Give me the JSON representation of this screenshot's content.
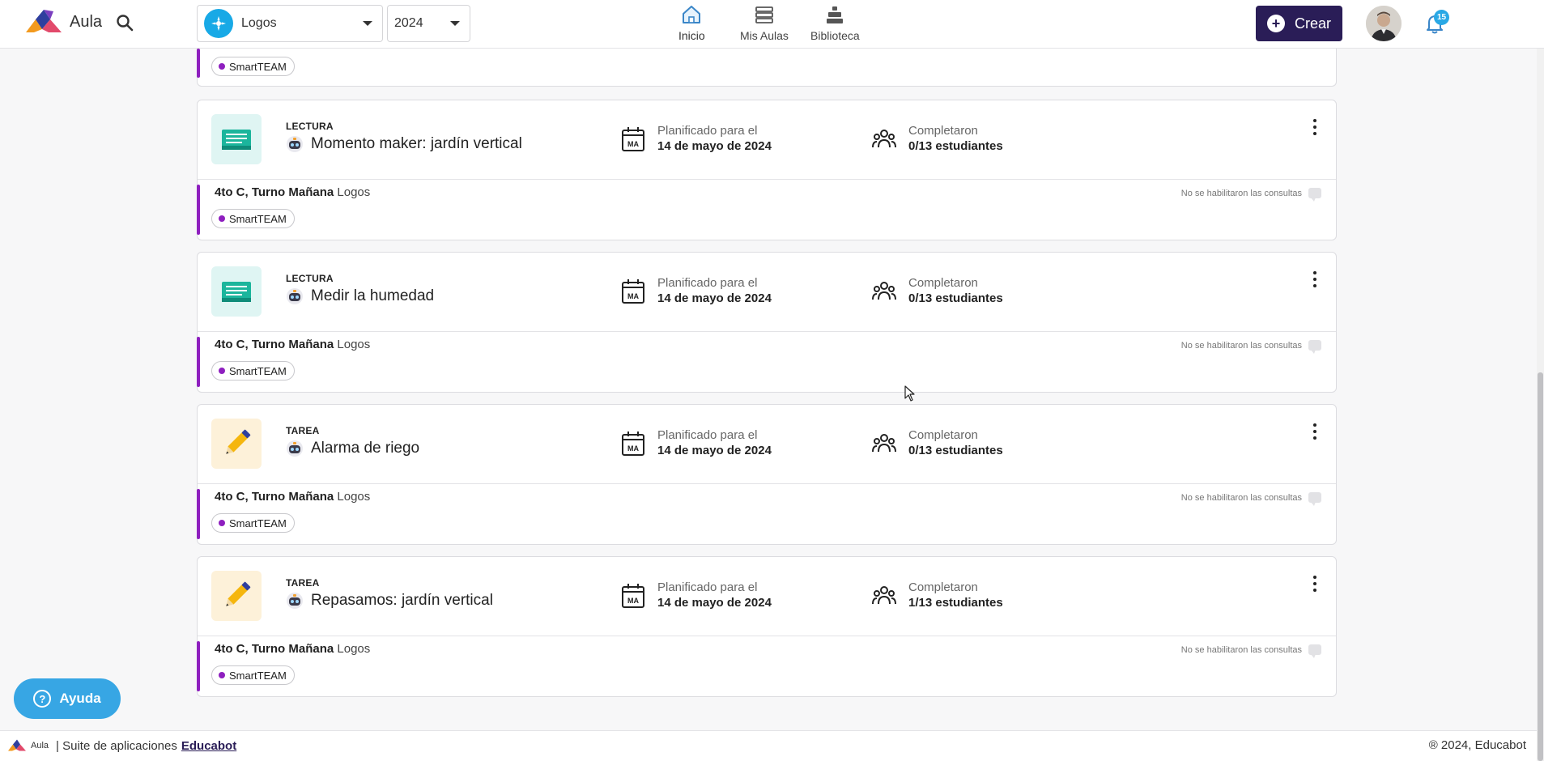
{
  "app": {
    "name": "Aula"
  },
  "header": {
    "school_select": {
      "value": "Logos"
    },
    "year_select": {
      "value": "2024"
    },
    "nav": [
      {
        "label": "Inicio",
        "icon": "home-icon",
        "active": true
      },
      {
        "label": "Mis Aulas",
        "icon": "classrooms-icon",
        "active": false
      },
      {
        "label": "Biblioteca",
        "icon": "library-icon",
        "active": false
      }
    ],
    "create_label": "Crear",
    "notifications_count": "15"
  },
  "partial_card": {
    "tag": "SmartTEAM"
  },
  "cards": [
    {
      "type_label": "LECTURA",
      "type_icon": "book-icon",
      "title": "Momento maker: jardín vertical",
      "scheduled_label": "Planificado para el",
      "scheduled_value": "14 de mayo de 2024",
      "completed_label": "Completaron",
      "completed_value": "0/13 estudiantes",
      "class_name": "4to C, Turno Mañana",
      "school": "Logos",
      "tag": "SmartTEAM",
      "consult_note": "No se habilitaron las consultas"
    },
    {
      "type_label": "LECTURA",
      "type_icon": "book-icon",
      "title": "Medir la humedad",
      "scheduled_label": "Planificado para el",
      "scheduled_value": "14 de mayo de 2024",
      "completed_label": "Completaron",
      "completed_value": "0/13 estudiantes",
      "class_name": "4to C, Turno Mañana",
      "school": "Logos",
      "tag": "SmartTEAM",
      "consult_note": "No se habilitaron las consultas"
    },
    {
      "type_label": "TAREA",
      "type_icon": "pencil-icon",
      "title": "Alarma de riego",
      "scheduled_label": "Planificado para el",
      "scheduled_value": "14 de mayo de 2024",
      "completed_label": "Completaron",
      "completed_value": "0/13 estudiantes",
      "class_name": "4to C, Turno Mañana",
      "school": "Logos",
      "tag": "SmartTEAM",
      "consult_note": "No se habilitaron las consultas"
    },
    {
      "type_label": "TAREA",
      "type_icon": "pencil-icon",
      "title": "Repasamos: jardín vertical",
      "scheduled_label": "Planificado para el",
      "scheduled_value": "14 de mayo de 2024",
      "completed_label": "Completaron",
      "completed_value": "1/13 estudiantes",
      "class_name": "4to C, Turno Mañana",
      "school": "Logos",
      "tag": "SmartTEAM",
      "consult_note": "No se habilitaron las consultas"
    }
  ],
  "calendar_badge": "MA",
  "help_label": "Ayuda",
  "footer": {
    "app_mini": "Aula",
    "suite_text": "| Suite de aplicaciones",
    "brand_link": "Educabot",
    "copyright": "® 2024, Educabot"
  },
  "colors": {
    "primary": "#2a1d57",
    "accent_purple": "#8e1fbf",
    "help_blue": "#37a6e4",
    "lectura_bg": "#dff5f3",
    "tarea_bg": "#fdf1d9"
  }
}
